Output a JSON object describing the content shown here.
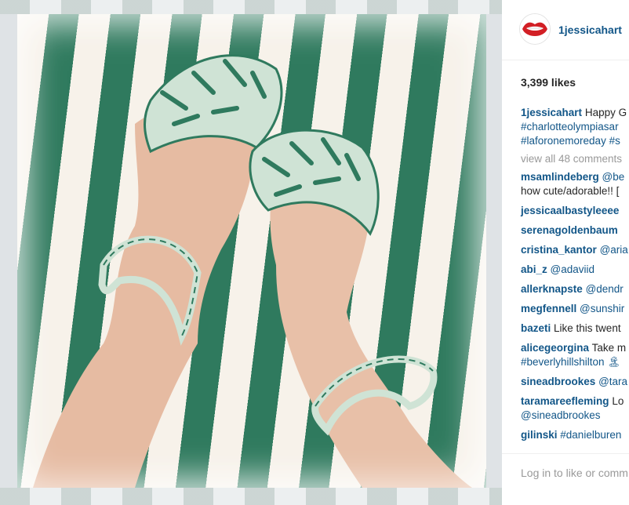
{
  "post": {
    "username": "1jessicahart",
    "likes": "3,399 likes",
    "caption": {
      "user": "1jessicahart",
      "text": "Happy G",
      "line2": "#charlotteolympiasar",
      "line3a": "#laforonemoreday",
      "line3b": "#s"
    },
    "view_all": "view all 48 comments",
    "comments": [
      {
        "user": "msamlindeberg",
        "text": "@be",
        "line2": "how cute/adorable!! ["
      },
      {
        "user": "jessicaalbastyleeee",
        "text": ""
      },
      {
        "user": "serenagoldenbaum",
        "text": ""
      },
      {
        "user": "cristina_kantor",
        "text": "@aria"
      },
      {
        "user": "abi_z",
        "text": "@adaviid"
      },
      {
        "user": "allerknapste",
        "text": "@dendr"
      },
      {
        "user": "megfennell",
        "text": "@sunshir"
      },
      {
        "user": "bazeti",
        "text": "Like this twent"
      },
      {
        "user": "alicegeorgina",
        "text": "Take m",
        "line2": "#beverlyhillshilton 🏝"
      },
      {
        "user": "sineadbrookes",
        "text": "@tara"
      },
      {
        "user": "taramareefleming",
        "text": "Lo",
        "line2": "@sineadbrookes"
      },
      {
        "user": "gilinski",
        "text": "#danielburen"
      }
    ],
    "login_prompt": "Log in to like or comm"
  },
  "colors": {
    "link": "#125688",
    "text": "#262626",
    "muted": "#999999",
    "stripe_green": "#2f7a5e",
    "stripe_cream": "#f7f2ea"
  },
  "icons": {
    "avatar": "red-lips-avatar"
  }
}
